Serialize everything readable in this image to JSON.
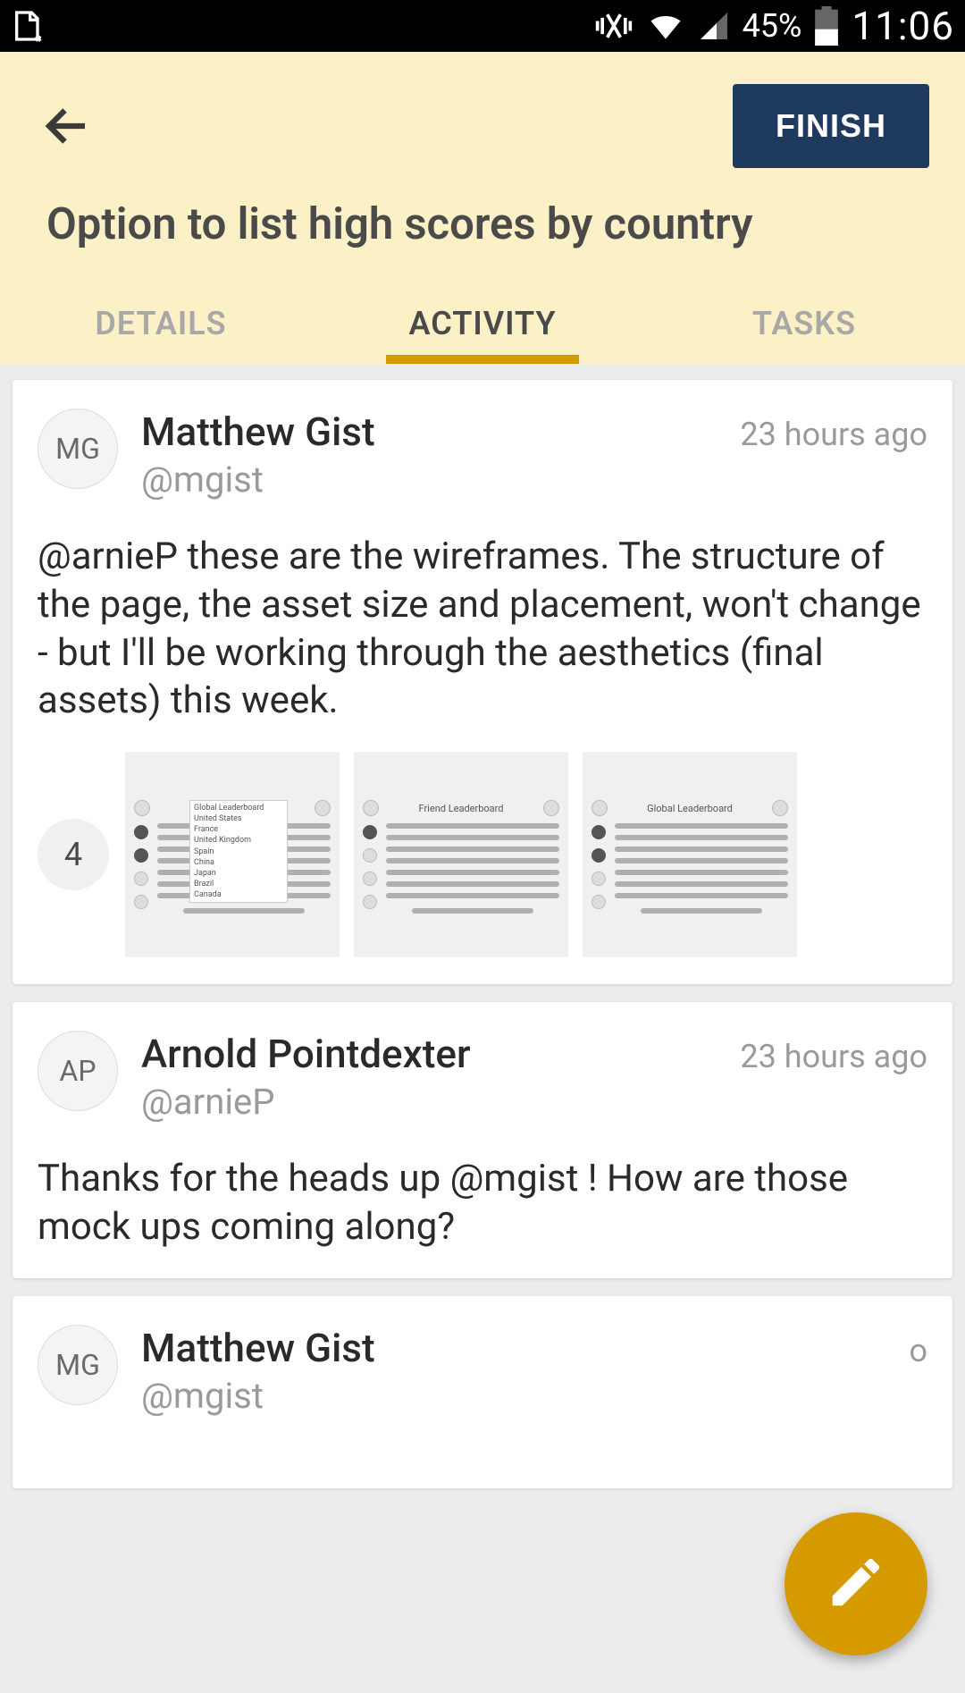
{
  "status_bar": {
    "battery_pct": "45%",
    "time": "11:06"
  },
  "header": {
    "finish_label": "FINISH",
    "title": "Option to list high scores by country"
  },
  "tabs": {
    "details": "DETAILS",
    "activity": "ACTIVITY",
    "tasks": "TASKS",
    "active": "activity"
  },
  "activity": [
    {
      "initials": "MG",
      "name": "Matthew Gist",
      "handle": "@mgist",
      "timestamp": "23 hours ago",
      "body": "@arnieP these are the wireframes. The structure of the page, the asset size and placement, won't change - but I'll be working through the aesthetics (final assets) this week.",
      "attachment_count": "4",
      "wireframes": [
        {
          "title": "Global Leaderboard",
          "dropdown": [
            "Global Leaderboard",
            "United States",
            "France",
            "United Kingdom",
            "Spain",
            "China",
            "Japan",
            "Brazil",
            "Canada"
          ]
        },
        {
          "title": "Friend Leaderboard"
        },
        {
          "title": "Global Leaderboard"
        }
      ]
    },
    {
      "initials": "AP",
      "name": "Arnold Pointdexter",
      "handle": "@arnieP",
      "timestamp": "23 hours ago",
      "body": "Thanks for the heads up @mgist !  How are those mock ups coming along?"
    },
    {
      "initials": "MG",
      "name": "Matthew Gist",
      "handle": "@mgist",
      "timestamp_suffix": "o"
    }
  ]
}
